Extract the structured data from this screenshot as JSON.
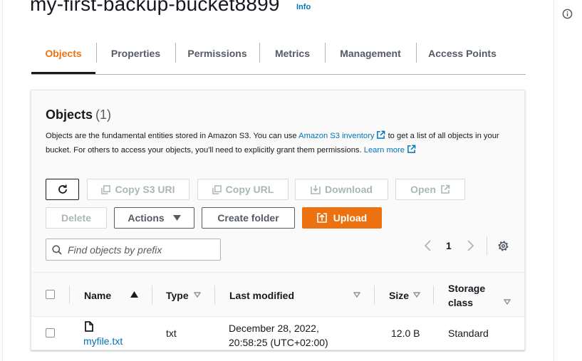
{
  "header": {
    "title": "my-first-backup-bucket8899",
    "info_label": "Info"
  },
  "tabs": [
    {
      "label": "Objects",
      "active": true
    },
    {
      "label": "Properties",
      "active": false
    },
    {
      "label": "Permissions",
      "active": false
    },
    {
      "label": "Metrics",
      "active": false
    },
    {
      "label": "Management",
      "active": false
    },
    {
      "label": "Access Points",
      "active": false
    }
  ],
  "objects_panel": {
    "title": "Objects",
    "count": "(1)",
    "description_part1": "Objects are the fundamental entities stored in Amazon S3. You can use ",
    "inventory_link": "Amazon S3 inventory",
    "description_part2": " to get a list of all objects in your bucket. For others to access your objects, you'll need to explicitly grant them permissions. ",
    "learn_more_link": "Learn more"
  },
  "toolbar": {
    "copy_s3_uri": "Copy S3 URI",
    "copy_url": "Copy URL",
    "download": "Download",
    "open": "Open",
    "delete": "Delete",
    "actions": "Actions",
    "create_folder": "Create folder",
    "upload": "Upload"
  },
  "search": {
    "placeholder": "Find objects by prefix",
    "value": ""
  },
  "pagination": {
    "current_page": "1"
  },
  "table": {
    "columns": {
      "name": "Name",
      "type": "Type",
      "last_modified": "Last modified",
      "size": "Size",
      "storage_class_line1": "Storage",
      "storage_class_line2": "class"
    },
    "rows": [
      {
        "name": "myfile.txt",
        "type": "txt",
        "last_modified_line1": "December 28, 2022,",
        "last_modified_line2": "20:58:25 (UTC+02:00)",
        "size": "12.0 B",
        "storage_class": "Standard"
      }
    ]
  },
  "colors": {
    "accent": "#ec7211",
    "link": "#0073bb",
    "text": "#16191f",
    "muted": "#545b64",
    "disabled": "#aab7b8"
  }
}
